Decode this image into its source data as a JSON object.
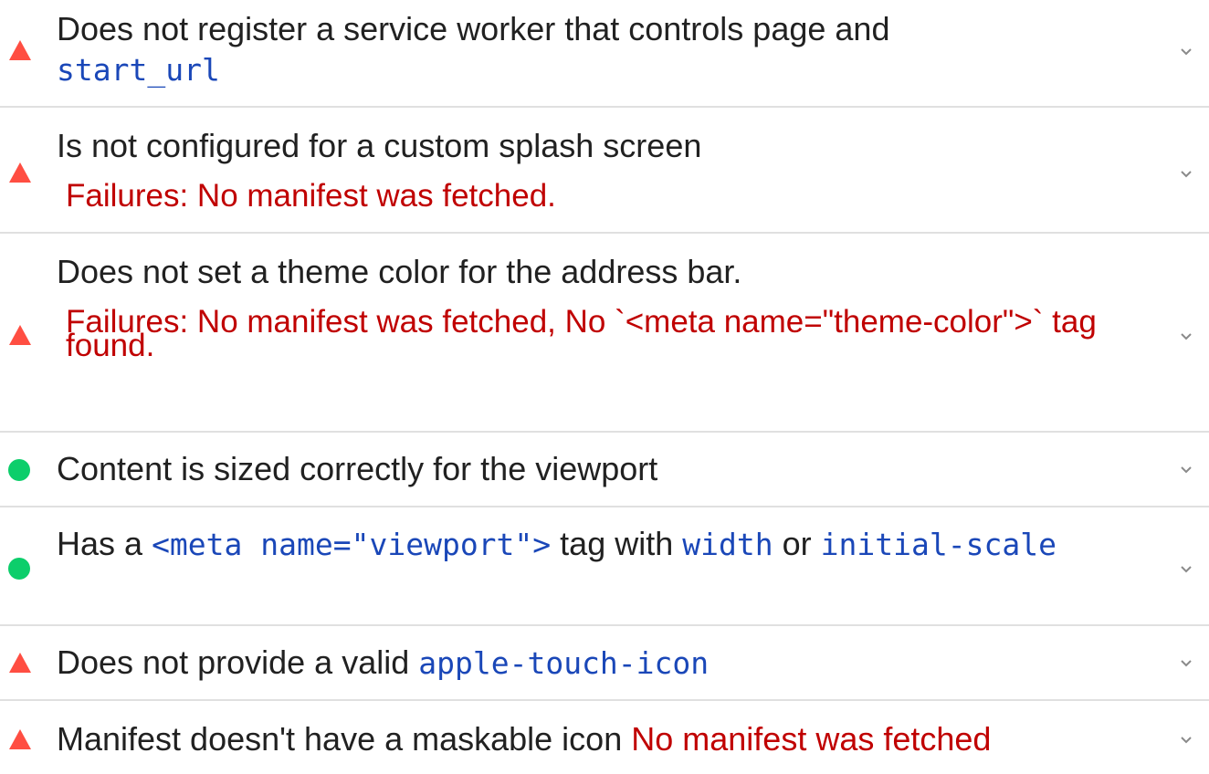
{
  "audits": [
    {
      "status": "fail",
      "title_before": "Does not register a service worker that controls page and",
      "code": "start_url"
    },
    {
      "status": "fail",
      "title": "Is not configured for a custom splash screen",
      "failures": "Failures: No manifest was fetched."
    },
    {
      "status": "fail",
      "title": "Does not set a theme color for the address bar.",
      "failures": "Failures: No manifest was fetched, No `<meta name=\"theme-color\">` tag found."
    },
    {
      "status": "pass",
      "title": "Content is sized correctly for the viewport"
    },
    {
      "status": "pass",
      "title_before": "Has a",
      "code1": "<meta name=\"viewport\">",
      "title_mid": "tag with",
      "code2": "width",
      "title_or": "or",
      "code3": "initial-scale"
    },
    {
      "status": "fail",
      "title_before": "Does not provide a valid",
      "code": "apple-touch-icon"
    },
    {
      "status": "fail",
      "title": "Manifest doesn't have a maskable icon",
      "inline_failure": "No manifest was fetched"
    }
  ],
  "colors": {
    "fail": "#ff4e42",
    "pass": "#0cce6b",
    "failure_text": "#c00000",
    "code_text": "#1a47b8",
    "divider": "#e0e0e0"
  },
  "icons": {
    "fail": "triangle-warning-icon",
    "pass": "green-circle-icon",
    "expand": "chevron-down-icon"
  }
}
